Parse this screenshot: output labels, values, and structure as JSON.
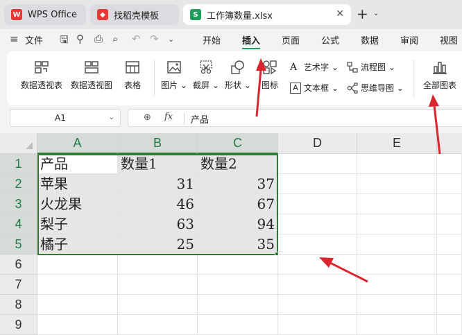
{
  "tabs": [
    {
      "label": "WPS Office",
      "icon": "wps-logo-icon",
      "color": "#e53935"
    },
    {
      "label": "找稻壳模板",
      "icon": "docer-icon",
      "color": "#e53935"
    },
    {
      "label": "工作簿数量.xlsx",
      "icon": "spreadsheet-icon",
      "color": "#1f9e5a",
      "active": true
    }
  ],
  "menu": {
    "file_label": "文件",
    "items": [
      "开始",
      "插入",
      "页面",
      "公式",
      "数据",
      "审阅",
      "视图"
    ],
    "active": "插入"
  },
  "ribbon": {
    "pivot_table": "数据透视表",
    "pivot_chart": "数据透视图",
    "table": "表格",
    "picture": "图片",
    "screenshot": "截屏",
    "shape": "形状",
    "icon": "图标",
    "art_text": "艺术字",
    "text_box": "文本框",
    "flowchart": "流程图",
    "mindmap": "思维导图",
    "all_charts": "全部图表"
  },
  "formula_bar": {
    "cell_ref": "A1",
    "fx": "fx",
    "content": "产品"
  },
  "sheet": {
    "columns": [
      "A",
      "B",
      "C",
      "D",
      "E"
    ],
    "rows": [
      "1",
      "2",
      "3",
      "4",
      "5",
      "6",
      "7",
      "8",
      "9"
    ],
    "header": [
      "产品",
      "数量1",
      "数量2"
    ],
    "data": [
      [
        "苹果",
        "31",
        "37"
      ],
      [
        "火龙果",
        "46",
        "67"
      ],
      [
        "梨子",
        "63",
        "94"
      ],
      [
        "橘子",
        "25",
        "35"
      ]
    ]
  },
  "colors": {
    "accent": "#1f9e5a",
    "selection_border": "#2e7d32",
    "annotation_arrow": "#d9252b"
  }
}
